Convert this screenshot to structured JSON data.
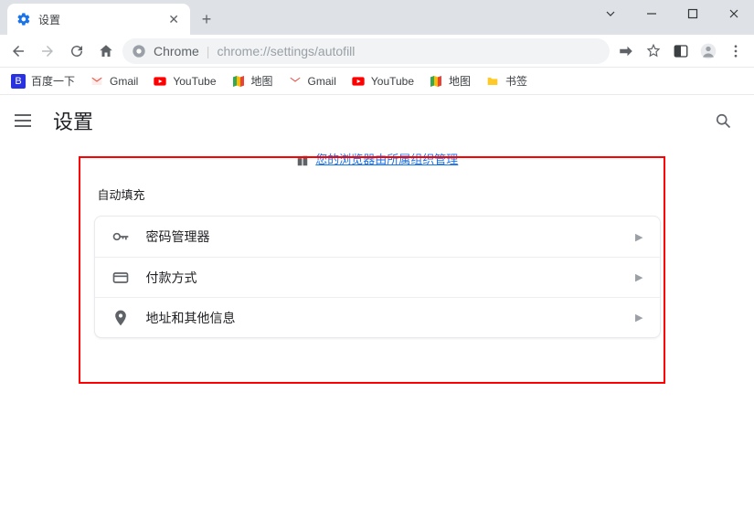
{
  "window": {
    "tab_title": "设置"
  },
  "nav": {
    "chrome_label": "Chrome",
    "url_path": "chrome://settings/autofill"
  },
  "bookmarks": [
    {
      "label": "百度一下",
      "icon": "baidu"
    },
    {
      "label": "Gmail",
      "icon": "gmail"
    },
    {
      "label": "YouTube",
      "icon": "youtube"
    },
    {
      "label": "地图",
      "icon": "maps"
    },
    {
      "label": "Gmail",
      "icon": "gmail"
    },
    {
      "label": "YouTube",
      "icon": "youtube"
    },
    {
      "label": "地图",
      "icon": "maps"
    },
    {
      "label": "书签",
      "icon": "folder"
    }
  ],
  "app": {
    "title": "设置",
    "managed_notice": "您的浏览器由所属组织管理"
  },
  "autofill": {
    "section_title": "自动填充",
    "rows": [
      {
        "label": "密码管理器",
        "icon": "key"
      },
      {
        "label": "付款方式",
        "icon": "card"
      },
      {
        "label": "地址和其他信息",
        "icon": "pin"
      }
    ]
  }
}
